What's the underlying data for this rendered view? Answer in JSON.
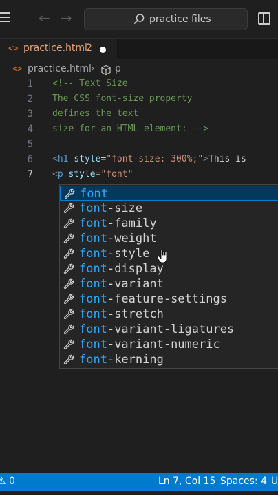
{
  "titlebar": {
    "search_text": "practice files"
  },
  "tab": {
    "icon": "<>",
    "name": "practice.html",
    "problems": "2"
  },
  "breadcrumb": {
    "icon": "<>",
    "file": "practice.html",
    "chevron": "›",
    "element": "p"
  },
  "editor": {
    "lines": [
      {
        "num": "1",
        "segments": [
          {
            "t": "<!-- Text Size",
            "c": "c-comment"
          }
        ]
      },
      {
        "num": "2",
        "segments": [
          {
            "t": "The CSS font-size property",
            "c": "c-comment"
          }
        ]
      },
      {
        "num": "3",
        "segments": [
          {
            "t": "defines the text",
            "c": "c-comment"
          }
        ]
      },
      {
        "num": "4",
        "segments": [
          {
            "t": "size for an HTML element: -->",
            "c": "c-comment"
          }
        ]
      },
      {
        "num": "5",
        "segments": []
      },
      {
        "num": "6",
        "segments": [
          {
            "t": "<",
            "c": "c-tag"
          },
          {
            "t": "h1",
            "c": "c-tagname"
          },
          {
            "t": " ",
            "c": "c-text"
          },
          {
            "t": "style",
            "c": "c-attr"
          },
          {
            "t": "=",
            "c": "c-text"
          },
          {
            "t": "\"font-size: 300%;\"",
            "c": "c-str"
          },
          {
            "t": ">",
            "c": "c-tag"
          },
          {
            "t": "This is",
            "c": "c-text"
          }
        ]
      },
      {
        "num": "7",
        "segments": [
          {
            "t": "<",
            "c": "c-tag"
          },
          {
            "t": "p",
            "c": "c-tagname"
          },
          {
            "t": " ",
            "c": "c-text"
          },
          {
            "t": "style",
            "c": "c-attr"
          },
          {
            "t": "=",
            "c": "c-text"
          },
          {
            "t": "\"font\"",
            "c": "c-str"
          }
        ]
      }
    ]
  },
  "suggestions": {
    "prefix": "font",
    "items": [
      {
        "match": "font",
        "rest": ""
      },
      {
        "match": "font",
        "rest": "-size"
      },
      {
        "match": "font",
        "rest": "-family"
      },
      {
        "match": "font",
        "rest": "-weight"
      },
      {
        "match": "font",
        "rest": "-style"
      },
      {
        "match": "font",
        "rest": "-display"
      },
      {
        "match": "font",
        "rest": "-variant"
      },
      {
        "match": "font",
        "rest": "-feature-settings"
      },
      {
        "match": "font",
        "rest": "-stretch"
      },
      {
        "match": "font",
        "rest": "-variant-ligatures"
      },
      {
        "match": "font",
        "rest": "-variant-numeric"
      },
      {
        "match": "font",
        "rest": "-kerning"
      }
    ],
    "selected_index": 0
  },
  "statusbar": {
    "warnings": "⚠ 0",
    "position": "Ln 7, Col 15",
    "spaces": "Spaces: 4",
    "encoding": "U"
  },
  "colors": {
    "statusbar": "#007acc",
    "accent": "#2aaaff",
    "selected_bg": "#04395e"
  }
}
